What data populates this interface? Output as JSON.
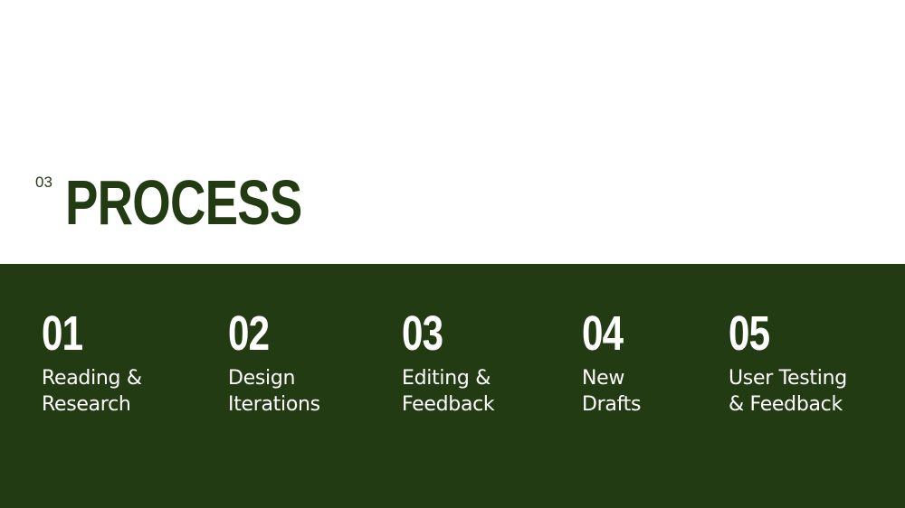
{
  "header": {
    "section_number": "03",
    "title": "PROCESS"
  },
  "steps": [
    {
      "number": "01",
      "label_line1": "Reading &",
      "label_line2": "Research"
    },
    {
      "number": "02",
      "label_line1": "Design",
      "label_line2": "Iterations"
    },
    {
      "number": "03",
      "label_line1": "Editing &",
      "label_line2": "Feedback"
    },
    {
      "number": "04",
      "label_line1": "New",
      "label_line2": "Drafts"
    },
    {
      "number": "05",
      "label_line1": "User Testing",
      "label_line2": "& Feedback"
    }
  ],
  "colors": {
    "brand_green": "#223b12",
    "background": "#ffffff",
    "text_on_green": "#ffffff"
  }
}
